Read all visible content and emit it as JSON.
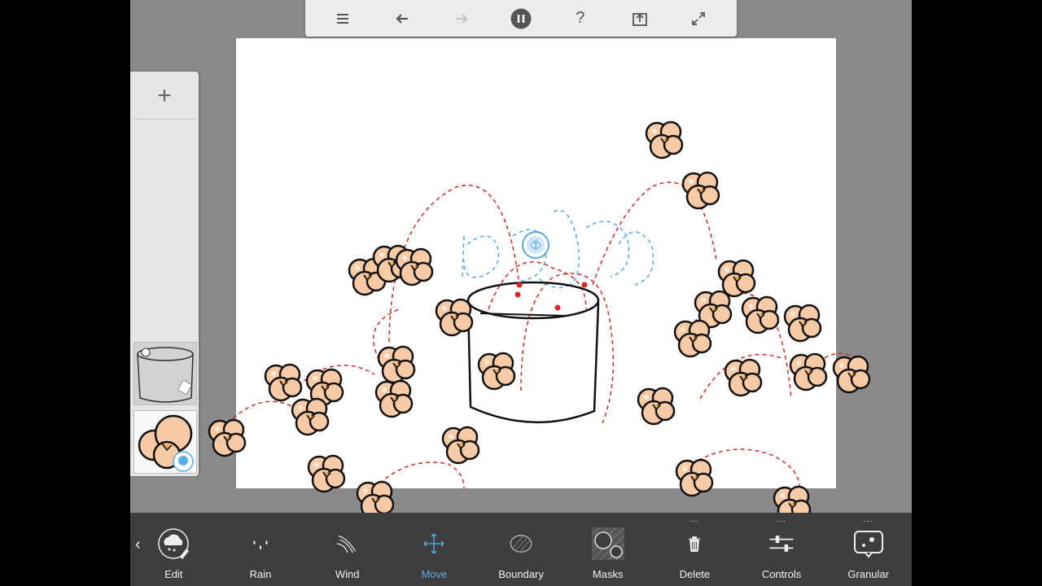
{
  "toolbar": {
    "buttons": [
      {
        "name": "menu-icon"
      },
      {
        "name": "undo-icon"
      },
      {
        "name": "redo-icon",
        "disabled": true
      },
      {
        "name": "pause-icon"
      },
      {
        "name": "help-icon",
        "glyph": "?"
      },
      {
        "name": "share-icon"
      },
      {
        "name": "fullscreen-icon"
      }
    ]
  },
  "layers": {
    "add_glyph": "+"
  },
  "tools": [
    {
      "id": "edit",
      "label": "Edit",
      "icon": "edit-rain-icon"
    },
    {
      "id": "rain",
      "label": "Rain",
      "icon": "rain-drops-icon"
    },
    {
      "id": "wind",
      "label": "Wind",
      "icon": "wind-icon"
    },
    {
      "id": "move",
      "label": "Move",
      "icon": "move-arrows-icon",
      "active": true
    },
    {
      "id": "boundary",
      "label": "Boundary",
      "icon": "boundary-icon"
    },
    {
      "id": "masks",
      "label": "Masks",
      "icon": "masks-icon"
    },
    {
      "id": "delete",
      "label": "Delete",
      "icon": "trash-icon",
      "more": "..."
    },
    {
      "id": "controls",
      "label": "Controls",
      "icon": "sliders-icon",
      "more": "..."
    },
    {
      "id": "granular",
      "label": "Granular",
      "icon": "granular-icon",
      "more": "..."
    }
  ],
  "colors": {
    "accent": "#5aaee8",
    "path": "#d62a2a",
    "wind": "#5aa8e0",
    "popcorn_fill": "#f8caa6",
    "popcorn_core": "#f3a84c"
  }
}
